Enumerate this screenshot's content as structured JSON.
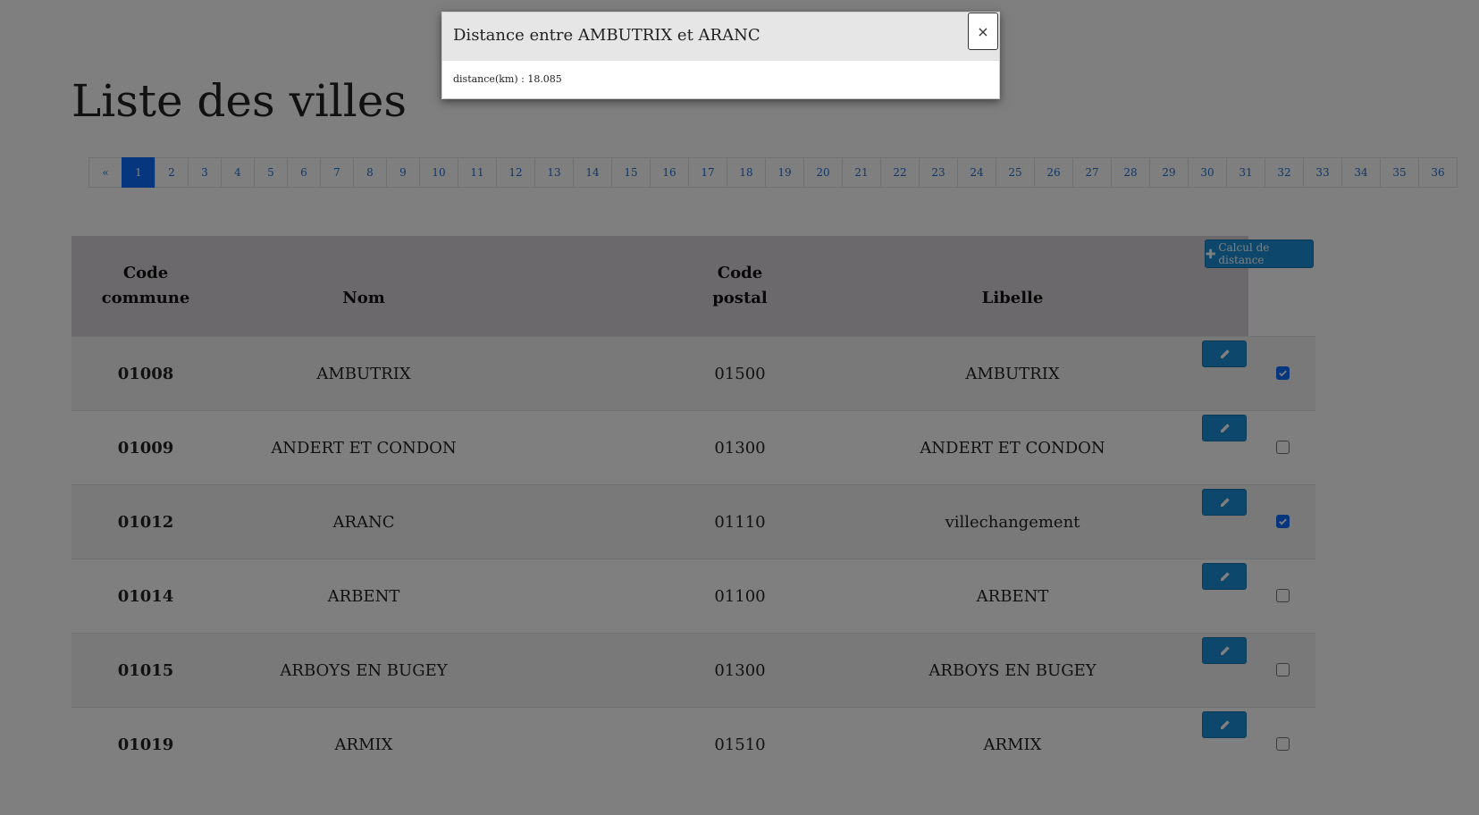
{
  "page": {
    "title": "Liste des villes"
  },
  "pagination": {
    "prev": "«",
    "pages": [
      "1",
      "2",
      "3",
      "4",
      "5",
      "6",
      "7",
      "8",
      "9",
      "10",
      "11",
      "12",
      "13",
      "14",
      "15",
      "16",
      "17",
      "18",
      "19",
      "20",
      "21",
      "22",
      "23",
      "24",
      "25",
      "26",
      "27",
      "28",
      "29",
      "30",
      "31",
      "32",
      "33",
      "34",
      "35",
      "36"
    ],
    "active": "1"
  },
  "table": {
    "headers": {
      "code_commune_1": "Code",
      "code_commune_2": "commune",
      "nom": "Nom",
      "code_postal_1": "Code",
      "code_postal_2": "postal",
      "libelle": "Libelle"
    },
    "calc_button": "Calcul de distance",
    "rows": [
      {
        "code": "01008",
        "nom": "AMBUTRIX",
        "cp": "01500",
        "libelle": "AMBUTRIX",
        "checked": true
      },
      {
        "code": "01009",
        "nom": "ANDERT ET CONDON",
        "cp": "01300",
        "libelle": "ANDERT ET CONDON",
        "checked": false
      },
      {
        "code": "01012",
        "nom": "ARANC",
        "cp": "01110",
        "libelle": "villechangement",
        "checked": true
      },
      {
        "code": "01014",
        "nom": "ARBENT",
        "cp": "01100",
        "libelle": "ARBENT",
        "checked": false
      },
      {
        "code": "01015",
        "nom": "ARBOYS EN BUGEY",
        "cp": "01300",
        "libelle": "ARBOYS EN BUGEY",
        "checked": false
      },
      {
        "code": "01019",
        "nom": "ARMIX",
        "cp": "01510",
        "libelle": "ARMIX",
        "checked": false
      }
    ]
  },
  "modal": {
    "title": "Distance entre AMBUTRIX et ARANC",
    "close": "×",
    "body": "distance(km) : 18.085"
  },
  "colors": {
    "primary": "#1b8fd6",
    "active_page": "#0d6efd",
    "header_bg": "#d6d3d6"
  },
  "icons": {
    "edit": "pencil-icon",
    "calc": "plus-icon"
  }
}
